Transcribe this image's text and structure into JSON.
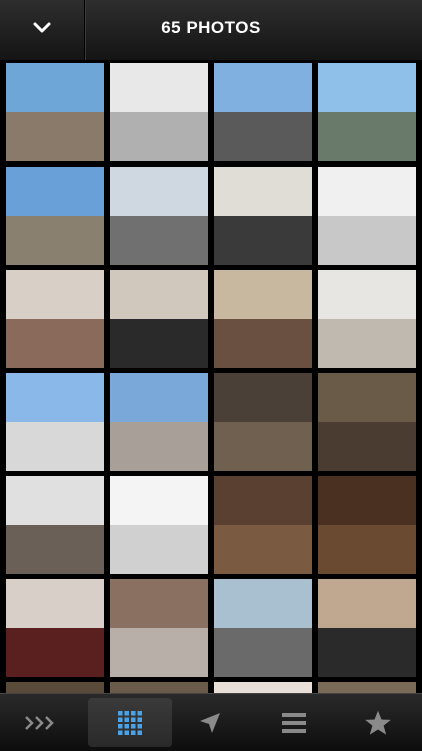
{
  "header": {
    "title": "65 PHOTOS"
  },
  "icons": {
    "back": "chevron-down-icon"
  },
  "tabs": [
    {
      "name": "slideshow",
      "icon": "chevrons-right-icon",
      "active": false
    },
    {
      "name": "grid",
      "icon": "grid-icon",
      "active": true
    },
    {
      "name": "map",
      "icon": "location-arrow-icon",
      "active": false
    },
    {
      "name": "list",
      "icon": "list-icon",
      "active": false
    },
    {
      "name": "favorites",
      "icon": "star-icon",
      "active": false
    }
  ],
  "colors": {
    "accent": "#4aa3e8",
    "tab_icon": "#8a8a8a",
    "background": "#000000"
  }
}
